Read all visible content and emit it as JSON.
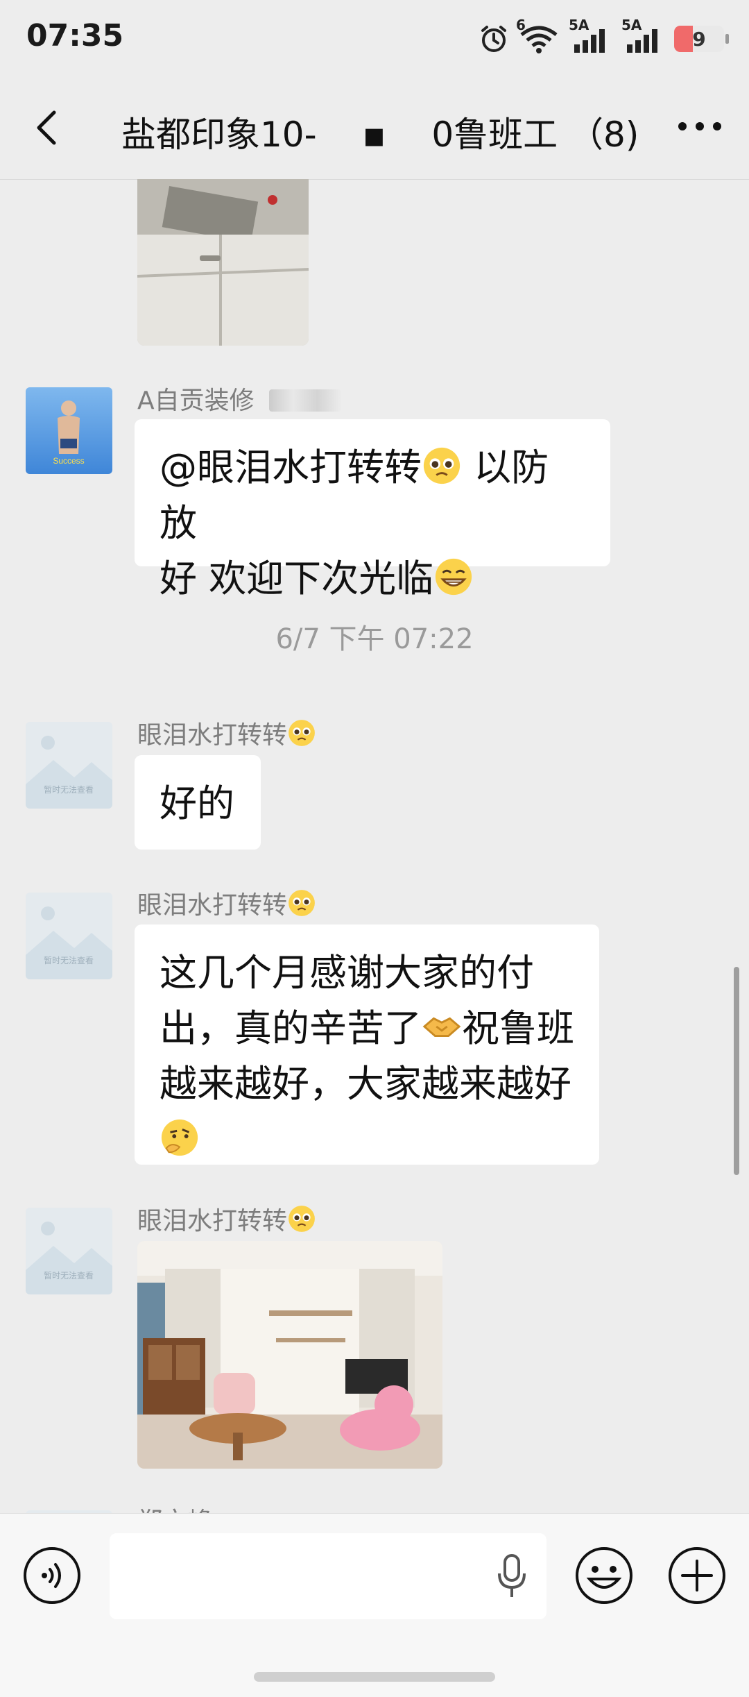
{
  "status_bar": {
    "time": "07:35",
    "network_label_1": "5A",
    "network_label_2": "5A",
    "wifi_label": "6",
    "battery_level": "9",
    "battery_color": "#f06a6a"
  },
  "nav": {
    "title": "盐都印象10-　 ▪　 0鲁班工 （8)"
  },
  "messages": [
    {
      "sender": "A自贡装修",
      "text_1": "@眼泪水打转转",
      "text_2": "以防放",
      "text_3": "好 欢迎下次光临"
    },
    {
      "timestamp": "6/7 下午 07:22"
    },
    {
      "sender": "眼泪水打转转",
      "text": "好的"
    },
    {
      "sender": "眼泪水打转转",
      "line_1": "这几个月感谢大家的付",
      "line_2a": "出，真的辛苦了",
      "line_2b": "祝鲁班",
      "line_3": "越来越好，大家越来越好"
    },
    {
      "sender": "眼泪水打转转"
    },
    {
      "sender": "郑文峰"
    }
  ],
  "avatar_placeholder_text": "暂时无法查看",
  "avatar_success_text": "Success",
  "icons": [
    "back-arrow-icon",
    "more-icon",
    "alarm-icon",
    "wifi-icon",
    "signal-icon",
    "voice-icon",
    "mic-icon",
    "emoji-icon",
    "add-icon"
  ]
}
